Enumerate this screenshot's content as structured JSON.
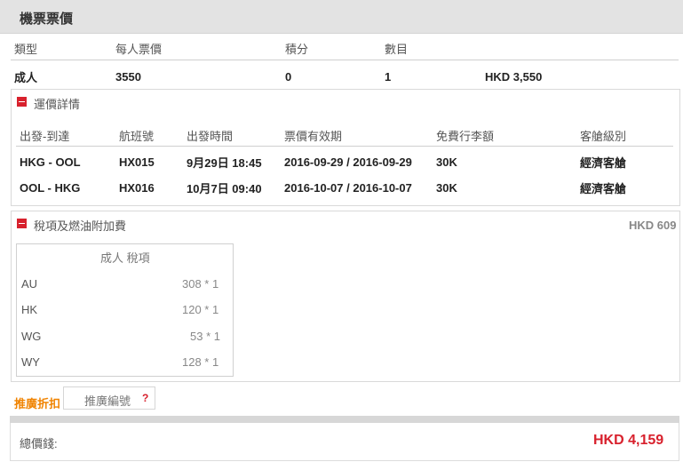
{
  "section_title": "機票票價",
  "fare_table": {
    "headers": [
      "類型",
      "每人票價",
      "積分",
      "數目"
    ],
    "row": {
      "type": "成人",
      "price": "3550",
      "points": "0",
      "count": "1",
      "subtotal": "HKD 3,550"
    }
  },
  "itinerary": {
    "title": "運價詳情",
    "headers": [
      "出發-到達",
      "航班號",
      "出發時間",
      "票價有效期",
      "免費行李額",
      "客艙級別"
    ],
    "rows": [
      {
        "route": "HKG - OOL",
        "flight": "HX015",
        "time": "9月29日 18:45",
        "validity": "2016-09-29 / 2016-09-29",
        "baggage": "30K",
        "cabin": "經濟客艙"
      },
      {
        "route": "OOL - HKG",
        "flight": "HX016",
        "time": "10月7日 09:40",
        "validity": "2016-10-07 / 2016-10-07",
        "baggage": "30K",
        "cabin": "經濟客艙"
      }
    ]
  },
  "taxes": {
    "title": "稅項及燃油附加費",
    "total": "HKD 609",
    "box_title": "成人 稅項",
    "items": [
      {
        "code": "AU",
        "amount": "308 * 1"
      },
      {
        "code": "HK",
        "amount": "120 * 1"
      },
      {
        "code": "WG",
        "amount": "53 * 1"
      },
      {
        "code": "WY",
        "amount": "128 * 1"
      }
    ]
  },
  "promo": {
    "label": "推廣折扣",
    "placeholder": "推廣編號",
    "help_icon": "?"
  },
  "total": {
    "label": "總價錢:",
    "value": "HKD 4,159"
  },
  "colors": {
    "accent_red": "#d8212d",
    "promo_orange": "#f08300",
    "header_gray": "#e3e3e3"
  },
  "icons": {
    "collapse": "minus-square-icon",
    "help": "question-mark-icon"
  }
}
